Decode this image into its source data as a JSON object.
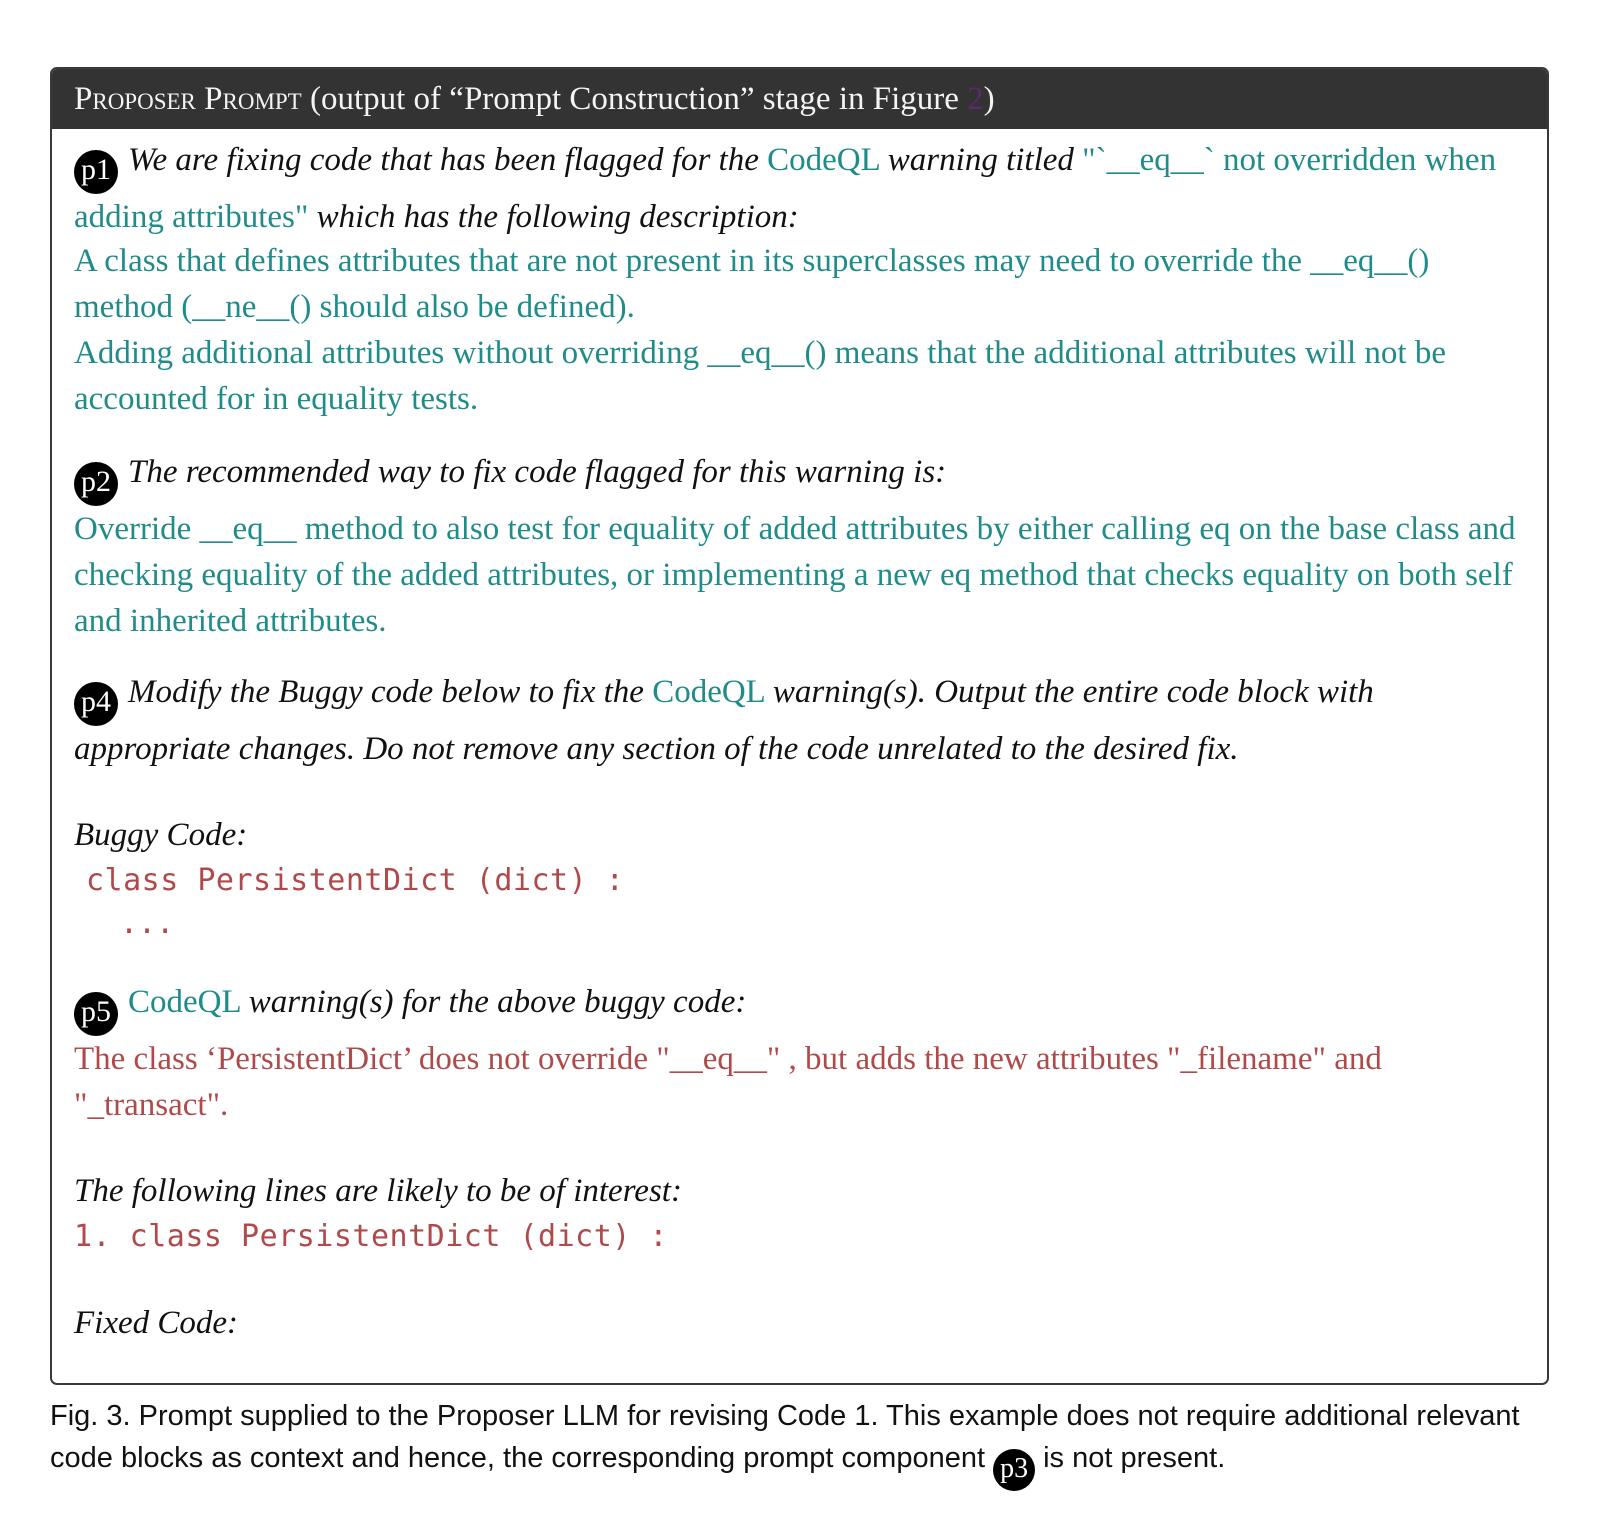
{
  "header": {
    "title_part1": "Proposer Prompt",
    "title_part2": " (output of “Prompt Construction” stage in Figure ",
    "figure_ref": "2",
    "title_part3": ")"
  },
  "p1": {
    "badge": "p1",
    "intro": "We are fixing code that has been flagged for the",
    "tool": "CodeQL",
    "mid": "warning titled",
    "warning_title": "\"`__eq__` not overridden when adding attributes\"",
    "after": "which has the following description:",
    "description_1": "A class that defines attributes that are not present in its superclasses may need to override the __eq__() method (__ne__() should also be defined).",
    "description_2": "Adding additional attributes without overriding __eq__() means that the additional attributes will not be accounted for in equality tests."
  },
  "p2": {
    "badge": "p2",
    "intro": "The recommended way to fix code flagged for this warning is:",
    "recommendation": "Override __eq__ method to also test for equality of added attributes by either calling eq on the base class and checking equality of the added attributes, or implementing a new eq method that checks equality on both self and inherited attributes."
  },
  "p4": {
    "badge": "p4",
    "intro": "Modify the Buggy code below to fix the",
    "tool": "CodeQL",
    "rest": "warning(s). Output the entire code block with appropriate changes. Do not remove any section of the code unrelated to the desired fix.",
    "buggy_label": "Buggy Code:",
    "code_line": "class PersistentDict (dict) :",
    "code_ellipsis": "..."
  },
  "p5": {
    "badge": "p5",
    "tool": "CodeQL",
    "intro_rest": "warning(s) for the above buggy code:",
    "warning_text": "The class ‘PersistentDict’ does not override \"__eq__\" , but adds the new attributes \"_filename\" and \"_transact\".",
    "lines_label": "The following lines are likely to be of interest:",
    "line_1": "1. class PersistentDict (dict) :",
    "fixed_label": "Fixed Code:"
  },
  "caption": {
    "text_1": "Fig. 3.  Prompt supplied to the Proposer LLM for revising Code 1. This example does not require additional relevant code blocks as context and hence, the corresponding prompt component",
    "badge": "p3",
    "text_2": "is not present."
  }
}
